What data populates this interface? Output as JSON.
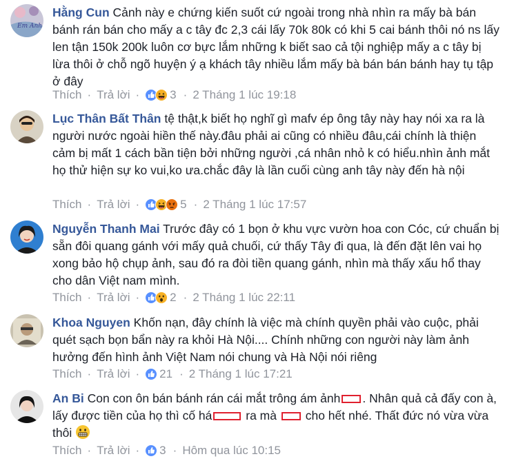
{
  "action_labels": {
    "like": "Thích",
    "reply": "Trả lời",
    "separator": "·"
  },
  "comments": [
    {
      "author": "Hằng Cun",
      "avatar_text": "Em Anh",
      "text": "Cảnh này e chứng kiến suốt cứ ngoài trong nhà nhìn ra mấy bà bán bánh rán bán cho mấy a c tây đc 2,3 cái lấy 70k 80k có khi 5 cai bánh thôi nó ns lấy len tận 150k 200k luôn cơ bực lắm những k biết sao cả tội nghiệp mấy a c tây bị lừa thôi ở chỗ ngõ huyện ý ạ khách tây nhiều lắm mấy bà bán bán bánh hay tụ tập ở đây",
      "reactions": [
        "like-icon",
        "haha-icon"
      ],
      "reaction_count": "3",
      "timestamp": "2 Tháng 1 lúc 19:18"
    },
    {
      "author": "Lục Thân Bất Thân",
      "text": "tệ thật,k biết họ nghĩ gì mafv ép ông tây này hay nói xa ra là người nước ngoài hiền thế này.đâu phải ai cũng có nhiều đâu,cái chính là thiện cảm bị mất 1 cách bần tiện bởi những người ,cá nhân nhỏ k có hiểu.nhìn ảnh mắt họ thử hiện sự ko vui,ko ưa.chắc đây là lần cuối cùng anh tây này đến hà nội",
      "reactions": [
        "like-icon",
        "haha-icon",
        "angry-icon"
      ],
      "reaction_count": "5",
      "timestamp": "2 Tháng 1 lúc 17:57"
    },
    {
      "author": "Nguyễn Thanh Mai",
      "text": "Trước đây có 1 bọn ở khu vực vườn hoa con Cóc, cứ chuẩn bị sẵn đôi quang gánh với mấy quả chuối, cứ thấy Tây đi qua, là đến đặt lên vai họ xong bảo hộ chụp ảnh, sau đó ra đòi tiền quang gánh, nhìn mà thấy xấu hổ thay cho dân Việt nam mình.",
      "reactions": [
        "like-icon",
        "wow-icon"
      ],
      "reaction_count": "2",
      "timestamp": "2 Tháng 1 lúc 22:11"
    },
    {
      "author": "Khoa Nguyen",
      "text": "Khốn nạn, đây chính là việc mà chính quyền phải vào cuộc, phải quét sạch bọn bẩn này ra khỏi Hà Nội.... Chính những con người này làm ảnh hưởng đến hình ảnh Việt Nam nói chung và Hà Nội nói riêng",
      "reactions": [
        "like-icon"
      ],
      "reaction_count": "21",
      "timestamp": "2 Tháng 1 lúc 17:21"
    },
    {
      "author": "An Bi",
      "text_parts": [
        "Con con ôn bán bánh rán cái mắt trông ám ảnh",
        ". Nhân quả cả đấy con à, lấy được tiền của họ thì cố há",
        " ra mà ",
        " cho hết nhé. Thất đức nó vừa vừa thôi"
      ],
      "reactions": [
        "like-icon"
      ],
      "reaction_count": "3",
      "timestamp": "Hôm qua lúc 10:15"
    }
  ],
  "colors": {
    "author": "#365899",
    "meta": "#90949c",
    "text": "#1d2129",
    "like": "#5890ff",
    "haha": "#f7b125",
    "angry": "#e9710f",
    "redact": "#e0202e"
  }
}
